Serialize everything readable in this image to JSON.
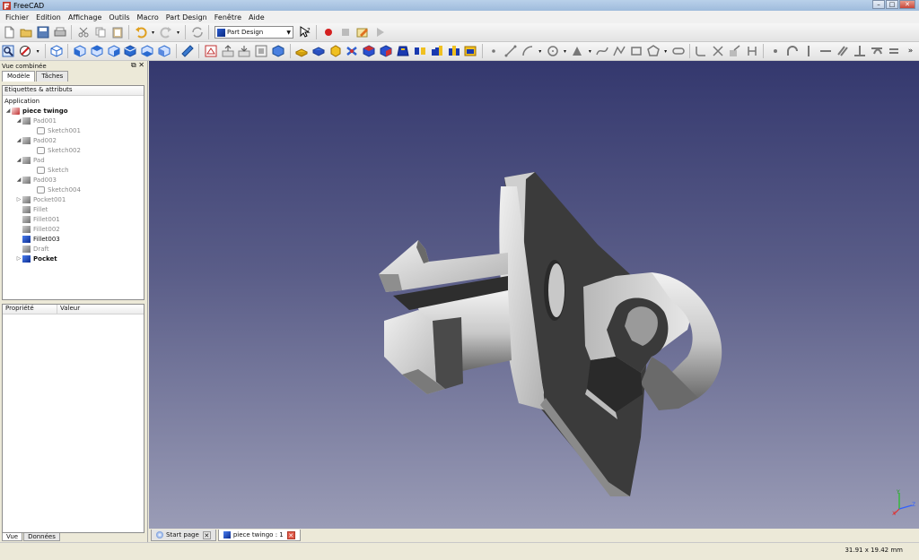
{
  "window": {
    "title": "FreeCAD"
  },
  "menu": [
    "Fichier",
    "Edition",
    "Affichage",
    "Outils",
    "Macro",
    "Part Design",
    "Fenêtre",
    "Aide"
  ],
  "workbench": {
    "selected": "Part Design"
  },
  "combo": {
    "title": "Vue combinée",
    "tabs": [
      "Modèle",
      "Tâches"
    ],
    "tree_header": "Etiquettes & attributs",
    "application": "Application",
    "document": "piece twingo",
    "items": [
      {
        "label": "Pad001",
        "level": 1,
        "expander": "◢",
        "icon": "part",
        "style": "grey"
      },
      {
        "label": "Sketch001",
        "level": 2,
        "expander": "",
        "icon": "sketch",
        "style": "grey"
      },
      {
        "label": "Pad002",
        "level": 1,
        "expander": "◢",
        "icon": "part",
        "style": "grey"
      },
      {
        "label": "Sketch002",
        "level": 2,
        "expander": "",
        "icon": "sketch",
        "style": "grey"
      },
      {
        "label": "Pad",
        "level": 1,
        "expander": "◢",
        "icon": "part",
        "style": "grey"
      },
      {
        "label": "Sketch",
        "level": 2,
        "expander": "",
        "icon": "sketch",
        "style": "grey"
      },
      {
        "label": "Pad003",
        "level": 1,
        "expander": "◢",
        "icon": "part",
        "style": "grey"
      },
      {
        "label": "Sketch004",
        "level": 2,
        "expander": "",
        "icon": "sketch",
        "style": "grey"
      },
      {
        "label": "Pocket001",
        "level": 1,
        "expander": "▷",
        "icon": "part",
        "style": "grey"
      },
      {
        "label": "Fillet",
        "level": 1,
        "expander": "",
        "icon": "part",
        "style": "grey"
      },
      {
        "label": "Fillet001",
        "level": 1,
        "expander": "",
        "icon": "part",
        "style": "grey"
      },
      {
        "label": "Fillet002",
        "level": 1,
        "expander": "",
        "icon": "part",
        "style": "grey"
      },
      {
        "label": "Fillet003",
        "level": 1,
        "expander": "",
        "icon": "part-blue",
        "style": "normal"
      },
      {
        "label": "Draft",
        "level": 1,
        "expander": "",
        "icon": "part",
        "style": "grey"
      },
      {
        "label": "Pocket",
        "level": 1,
        "expander": "▷",
        "icon": "part-blue",
        "style": "bold"
      }
    ],
    "property_headers": [
      "Propriété",
      "Valeur"
    ],
    "bottom_tabs": [
      "Vue",
      "Données"
    ]
  },
  "doc_tabs": [
    {
      "label": "Start page",
      "active": false
    },
    {
      "label": "piece twingo : 1",
      "active": true
    }
  ],
  "status": {
    "dimensions": "31.91 x 19.42 mm"
  },
  "colors": {
    "view_top": "#34386e",
    "view_bottom": "#9a9cb6",
    "model_light": "#d8d8d8",
    "model_dark": "#3a3a3a"
  }
}
